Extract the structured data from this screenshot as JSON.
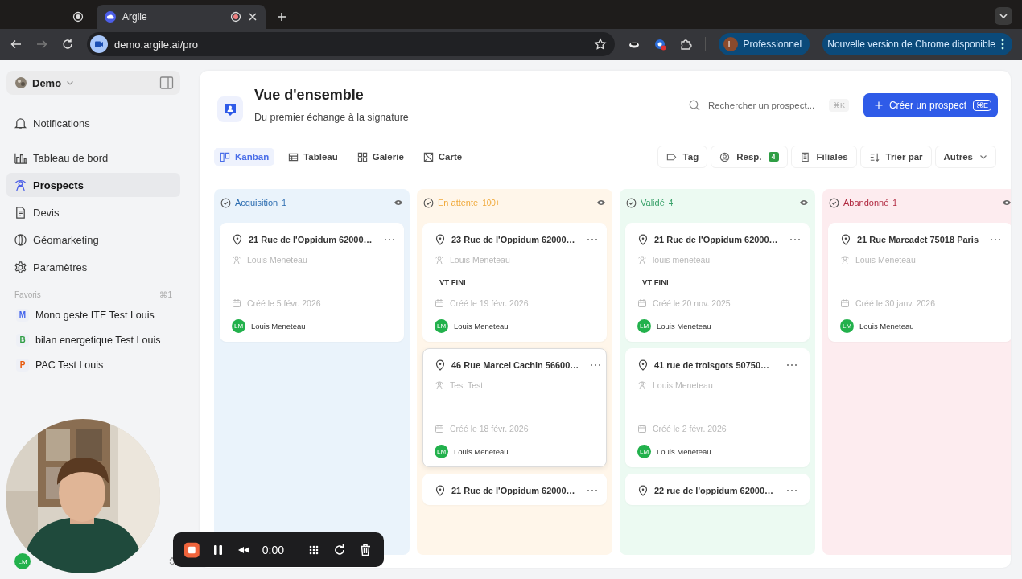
{
  "browser": {
    "tabs": [
      {
        "selected": false
      },
      {
        "title": "Argile",
        "selected": true
      }
    ],
    "url": "demo.argile.ai/pro",
    "profile": {
      "initial": "L",
      "name": "Professionnel"
    },
    "update_notice": "Nouvelle version de Chrome disponible"
  },
  "sidebar": {
    "workspace": "Demo",
    "items": [
      {
        "label": "Notifications",
        "selected": false
      },
      {
        "label": "Tableau de bord",
        "selected": false
      },
      {
        "label": "Prospects",
        "selected": true
      },
      {
        "label": "Devis",
        "selected": false
      },
      {
        "label": "Géomarketing",
        "selected": false
      },
      {
        "label": "Paramètres",
        "selected": false
      }
    ],
    "favorites_title": "Favoris",
    "favorites_shortcut": "⌘1",
    "favorites": [
      {
        "letter": "M",
        "label": "Mono geste ITE Test Louis",
        "color": "#4263eb"
      },
      {
        "letter": "B",
        "label": "bilan energetique Test Louis",
        "color": "#2f9e44"
      },
      {
        "letter": "P",
        "label": "PAC Test Louis",
        "color": "#e8590c"
      }
    ],
    "user_initials": "LM"
  },
  "header": {
    "title": "Vue d'ensemble",
    "subtitle": "Du premier échange à la signature",
    "search_placeholder": "Rechercher un prospect...",
    "search_shortcut": "⌘K",
    "create_label": "Créer un prospect",
    "create_shortcut": "⌘E"
  },
  "views": [
    {
      "label": "Kanban",
      "selected": true
    },
    {
      "label": "Tableau",
      "selected": false
    },
    {
      "label": "Galerie",
      "selected": false
    },
    {
      "label": "Carte",
      "selected": false
    }
  ],
  "filters": [
    {
      "label": "Tag"
    },
    {
      "label": "Resp.",
      "badge": "4"
    },
    {
      "label": "Filiales"
    },
    {
      "label": "Trier par"
    },
    {
      "label": "Autres"
    }
  ],
  "columns": [
    {
      "title": "Acquisition",
      "count": "1",
      "color": "#2b6cb0",
      "cards": [
        {
          "address": "21 Rue de l'Oppidum 62000…",
          "responsible": "Louis Meneteau",
          "created": "Créé le 5 févr. 2026",
          "owner_initials": "LM",
          "owner": "Louis Meneteau",
          "selected": false
        }
      ]
    },
    {
      "title": "En attente",
      "count": "100+",
      "color": "#f0a93a",
      "cards": [
        {
          "address": "23 Rue de l'Oppidum 62000…",
          "responsible": "Louis Meneteau",
          "tag": "VT FINI",
          "created": "Créé le 19 févr. 2026",
          "owner_initials": "LM",
          "owner": "Louis Meneteau",
          "selected": false
        },
        {
          "address": "46 Rue Marcel Cachin 56600…",
          "responsible": "Test Test",
          "created": "Créé le 18 févr. 2026",
          "owner_initials": "LM",
          "owner": "Louis Meneteau",
          "selected": true
        },
        {
          "address": "21 Rue de l'Oppidum 62000…",
          "selected": false
        }
      ]
    },
    {
      "title": "Validé",
      "count": "4",
      "color": "#38a169",
      "cards": [
        {
          "address": "21 Rue de l'Oppidum 62000…",
          "responsible": "louis meneteau",
          "tag": "VT FINI",
          "created": "Créé le 20 nov. 2025",
          "owner_initials": "LM",
          "owner": "Louis Meneteau",
          "selected": false
        },
        {
          "address": "41 rue de troisgots 50750…",
          "responsible": "Louis Meneteau",
          "created": "Créé le 2 févr. 2026",
          "owner_initials": "LM",
          "owner": "Louis Meneteau",
          "selected": false
        },
        {
          "address": "22 rue de l'oppidum 62000…",
          "selected": false
        }
      ]
    },
    {
      "title": "Abandonné",
      "count": "1",
      "color": "#b0283f",
      "cards": [
        {
          "address": "21 Rue Marcadet 75018 Paris",
          "responsible": "Louis Meneteau",
          "created": "Créé le 30 janv. 2026",
          "owner_initials": "LM",
          "owner": "Louis Meneteau",
          "selected": false
        }
      ]
    }
  ],
  "recorder": {
    "time": "0:00"
  }
}
